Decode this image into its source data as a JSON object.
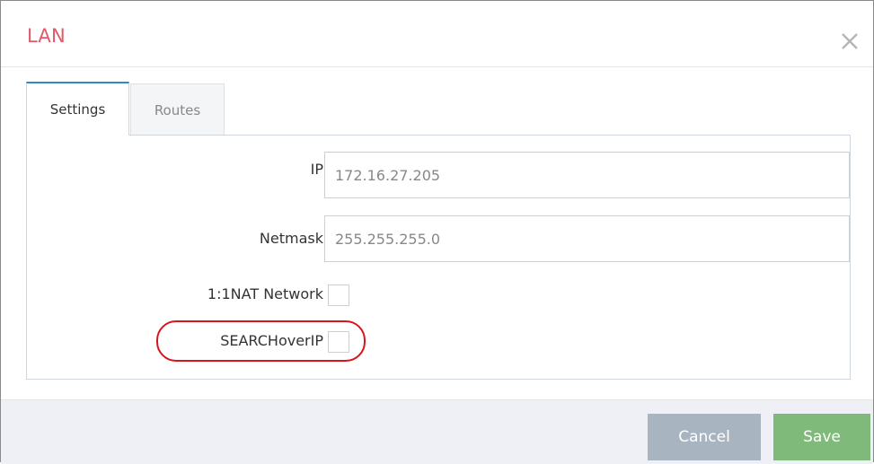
{
  "dialog": {
    "title": "LAN",
    "close_icon": "close-icon"
  },
  "tabs": [
    {
      "label": "Settings",
      "active": true
    },
    {
      "label": "Routes",
      "active": false
    }
  ],
  "form": {
    "ip": {
      "label": "IP",
      "value": "172.16.27.205"
    },
    "netmask": {
      "label": "Netmask",
      "value": "255.255.255.0"
    },
    "nat_network": {
      "label": "1:1NAT Network",
      "checked": false
    },
    "search_over_ip": {
      "label": "SEARCHoverIP",
      "checked": false,
      "highlighted": true
    }
  },
  "footer": {
    "cancel_label": "Cancel",
    "save_label": "Save"
  },
  "colors": {
    "title": "#e05a6a",
    "active_tab_accent": "#2e88c9",
    "cancel_button": "#a8b5c1",
    "save_button": "#7fba7a",
    "highlight_ring": "#d8141c"
  }
}
